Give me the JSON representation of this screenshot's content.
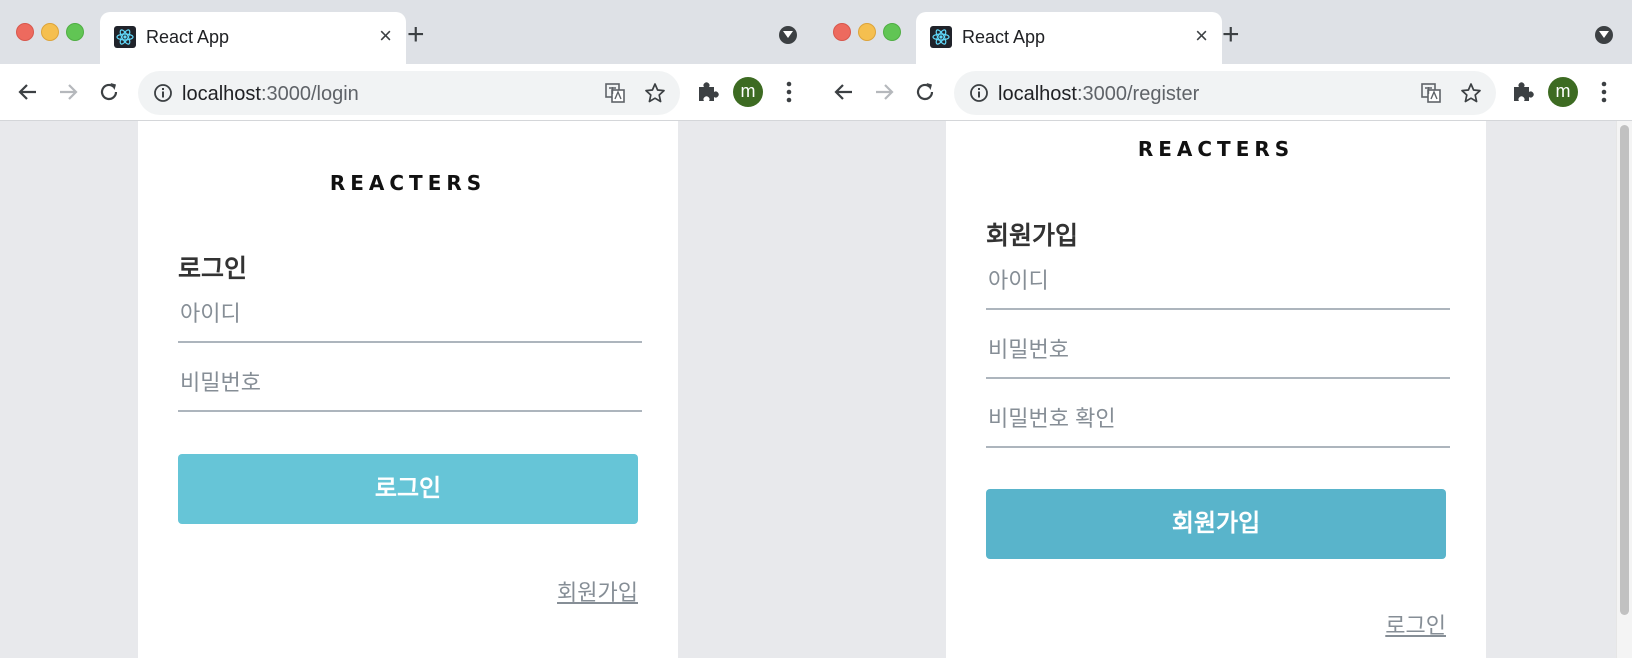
{
  "windows": [
    {
      "tab": {
        "title": "React App",
        "close": "×"
      },
      "new_tab": "+",
      "url": {
        "host": "localhost",
        "path": ":3000/login"
      },
      "avatar_letter": "m",
      "page": {
        "logo": "REACTERS",
        "form_title": "로그인",
        "inputs": [
          {
            "placeholder": "아이디"
          },
          {
            "placeholder": "비밀번호"
          }
        ],
        "submit_label": "로그인",
        "submit_color": "#66c5d7",
        "footer_link": "회원가입"
      }
    },
    {
      "tab": {
        "title": "React App",
        "close": "×"
      },
      "new_tab": "+",
      "url": {
        "host": "localhost",
        "path": ":3000/register"
      },
      "avatar_letter": "m",
      "page": {
        "logo": "REACTERS",
        "form_title": "회원가입",
        "inputs": [
          {
            "placeholder": "아이디"
          },
          {
            "placeholder": "비밀번호"
          },
          {
            "placeholder": "비밀번호 확인"
          }
        ],
        "submit_label": "회원가입",
        "submit_color": "#59b4cb",
        "footer_link": "로그인"
      }
    }
  ],
  "icons": {
    "back": "arrow-left-icon",
    "forward": "arrow-right-icon",
    "reload": "reload-icon",
    "info": "info-icon",
    "translate": "translate-icon",
    "bookmark": "star-icon",
    "extensions": "puzzle-icon",
    "menu": "kebab-menu-icon",
    "favicon": "react-logo-icon"
  }
}
